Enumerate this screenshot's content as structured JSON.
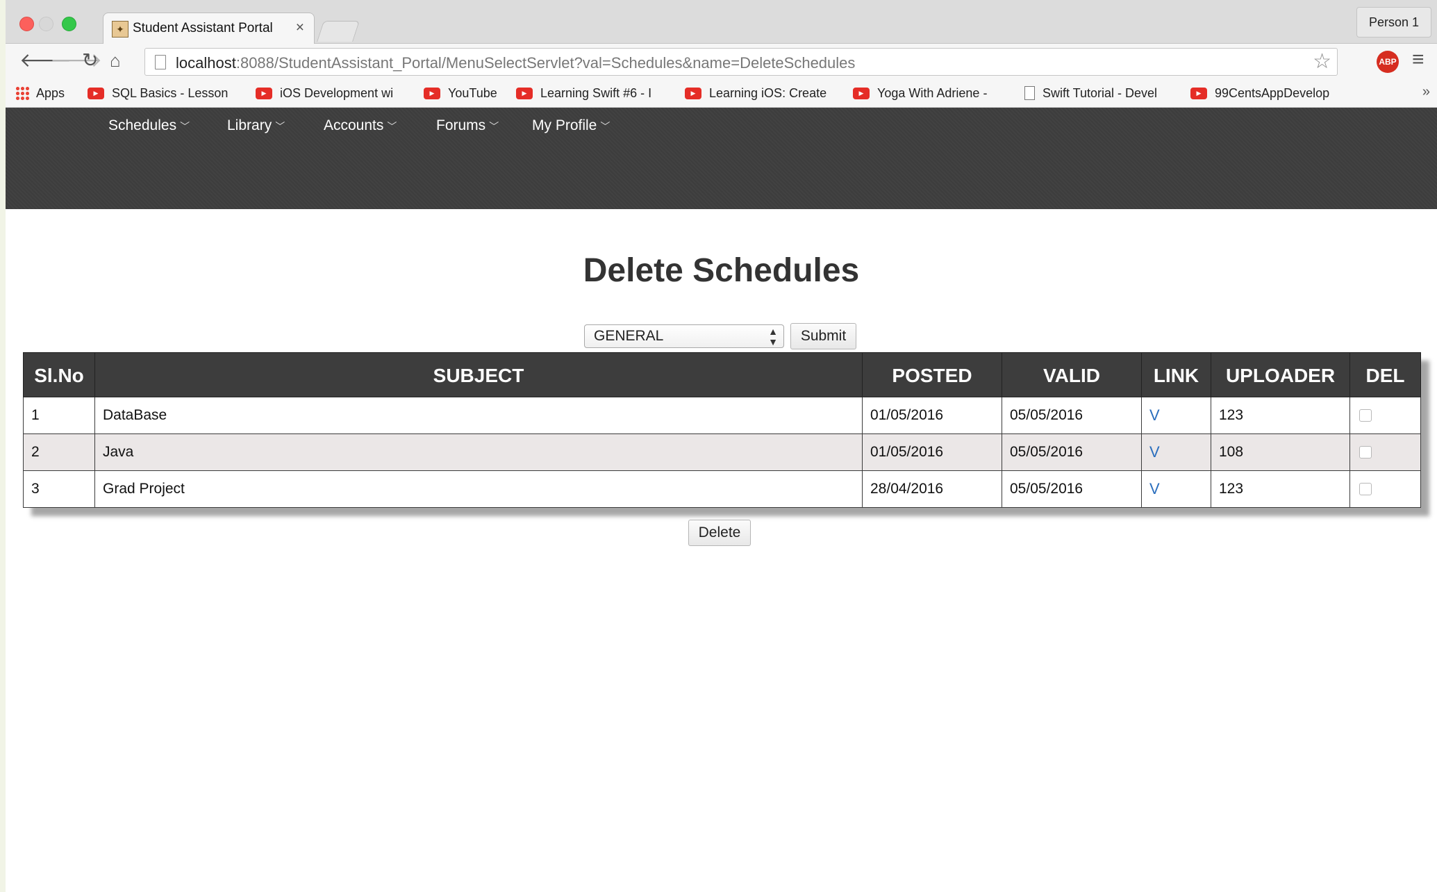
{
  "browser": {
    "tab_title": "Student Assistant Portal",
    "tab_close": "×",
    "person_label": "Person 1",
    "url_host": "localhost",
    "url_rest": ":8088/StudentAssistant_Portal/MenuSelectServlet?val=Schedules&name=DeleteSchedules",
    "abp_label": "ABP",
    "bookmarks": [
      {
        "label": "Apps",
        "icon": "apps-grid-icon"
      },
      {
        "label": "SQL Basics - Lesson",
        "icon": "youtube-icon"
      },
      {
        "label": "iOS Development wi",
        "icon": "youtube-icon"
      },
      {
        "label": "YouTube",
        "icon": "youtube-icon"
      },
      {
        "label": "Learning Swift #6 - I",
        "icon": "youtube-icon"
      },
      {
        "label": "Learning iOS: Create",
        "icon": "youtube-icon"
      },
      {
        "label": "Yoga With Adriene -",
        "icon": "youtube-icon"
      },
      {
        "label": "Swift Tutorial - Devel",
        "icon": "document-icon"
      },
      {
        "label": "99CentsAppDevelop",
        "icon": "youtube-icon"
      }
    ]
  },
  "nav": {
    "items": [
      "Schedules",
      "Library",
      "Accounts",
      "Forums",
      "My Profile"
    ]
  },
  "page": {
    "title": "Delete Schedules",
    "filter_value": "GENERAL",
    "submit_label": "Submit",
    "delete_label": "Delete"
  },
  "table": {
    "headers": [
      "Sl.No",
      "SUBJECT",
      "POSTED",
      "VALID",
      "LINK",
      "UPLOADER",
      "DEL"
    ],
    "rows": [
      {
        "slno": "1",
        "subject": "DataBase",
        "posted": "01/05/2016",
        "valid": "05/05/2016",
        "link": "V",
        "uploader": "123",
        "del": false
      },
      {
        "slno": "2",
        "subject": "Java",
        "posted": "01/05/2016",
        "valid": "05/05/2016",
        "link": "V",
        "uploader": "108",
        "del": false
      },
      {
        "slno": "3",
        "subject": "Grad Project",
        "posted": "28/04/2016",
        "valid": "05/05/2016",
        "link": "V",
        "uploader": "123",
        "del": false
      }
    ]
  },
  "colors": {
    "nav_background": "#3e3e3e",
    "table_header": "#3d3d3d",
    "link": "#2a6ebd",
    "alt_row": "#ebe7e7"
  }
}
